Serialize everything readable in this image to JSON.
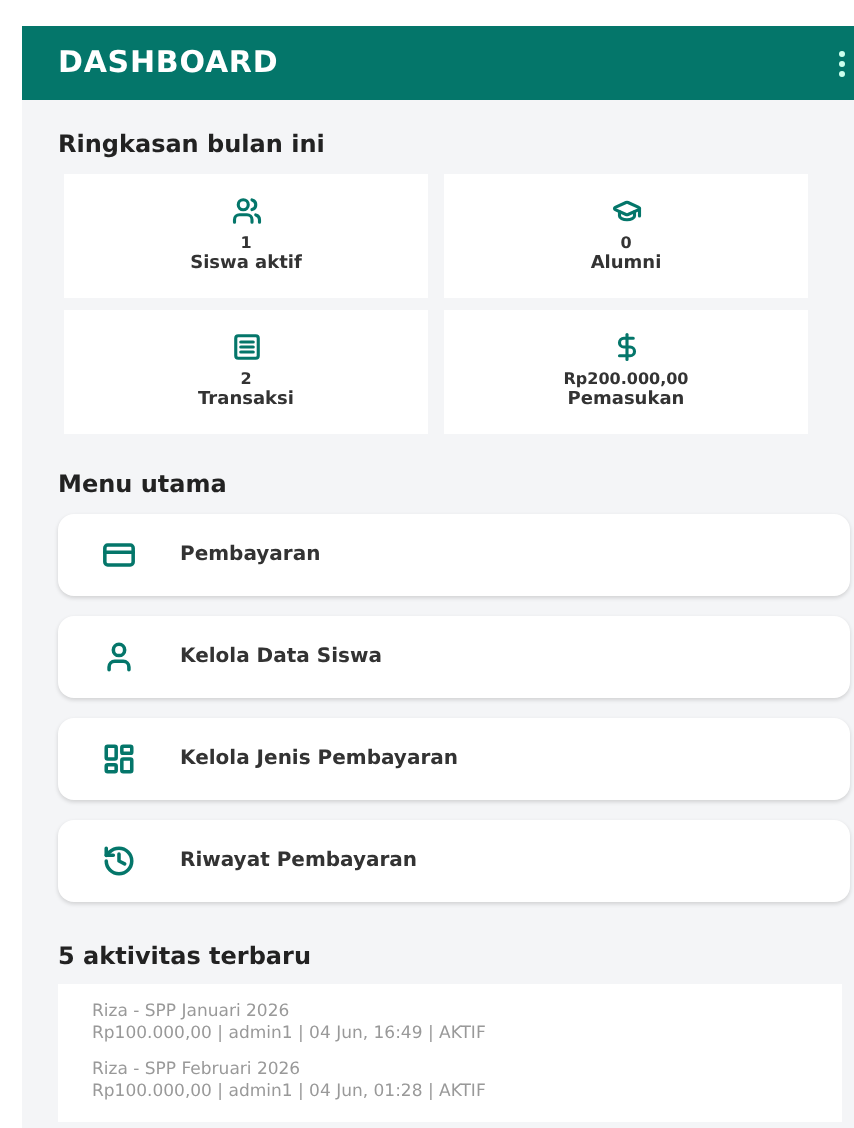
{
  "app_bar": {
    "title": "DASHBOARD"
  },
  "summary": {
    "heading": "Ringkasan bulan ini",
    "cards": [
      {
        "value": "1",
        "label": "Siswa aktif"
      },
      {
        "value": "0",
        "label": "Alumni"
      },
      {
        "value": "2",
        "label": "Transaksi"
      },
      {
        "value": "Rp200.000,00",
        "label": "Pemasukan"
      }
    ]
  },
  "menu": {
    "heading": "Menu utama",
    "items": [
      {
        "label": "Pembayaran"
      },
      {
        "label": "Kelola Data Siswa"
      },
      {
        "label": "Kelola Jenis Pembayaran"
      },
      {
        "label": "Riwayat Pembayaran"
      }
    ]
  },
  "activities": {
    "heading": "5 aktivitas terbaru",
    "items": [
      {
        "title": "Riza - SPP Januari 2026",
        "detail": "Rp100.000,00 | admin1 | 04 Jun, 16:49 | AKTIF"
      },
      {
        "title": "Riza - SPP Februari 2026",
        "detail": "Rp100.000,00 | admin1 | 04 Jun, 01:28 | AKTIF"
      }
    ]
  }
}
